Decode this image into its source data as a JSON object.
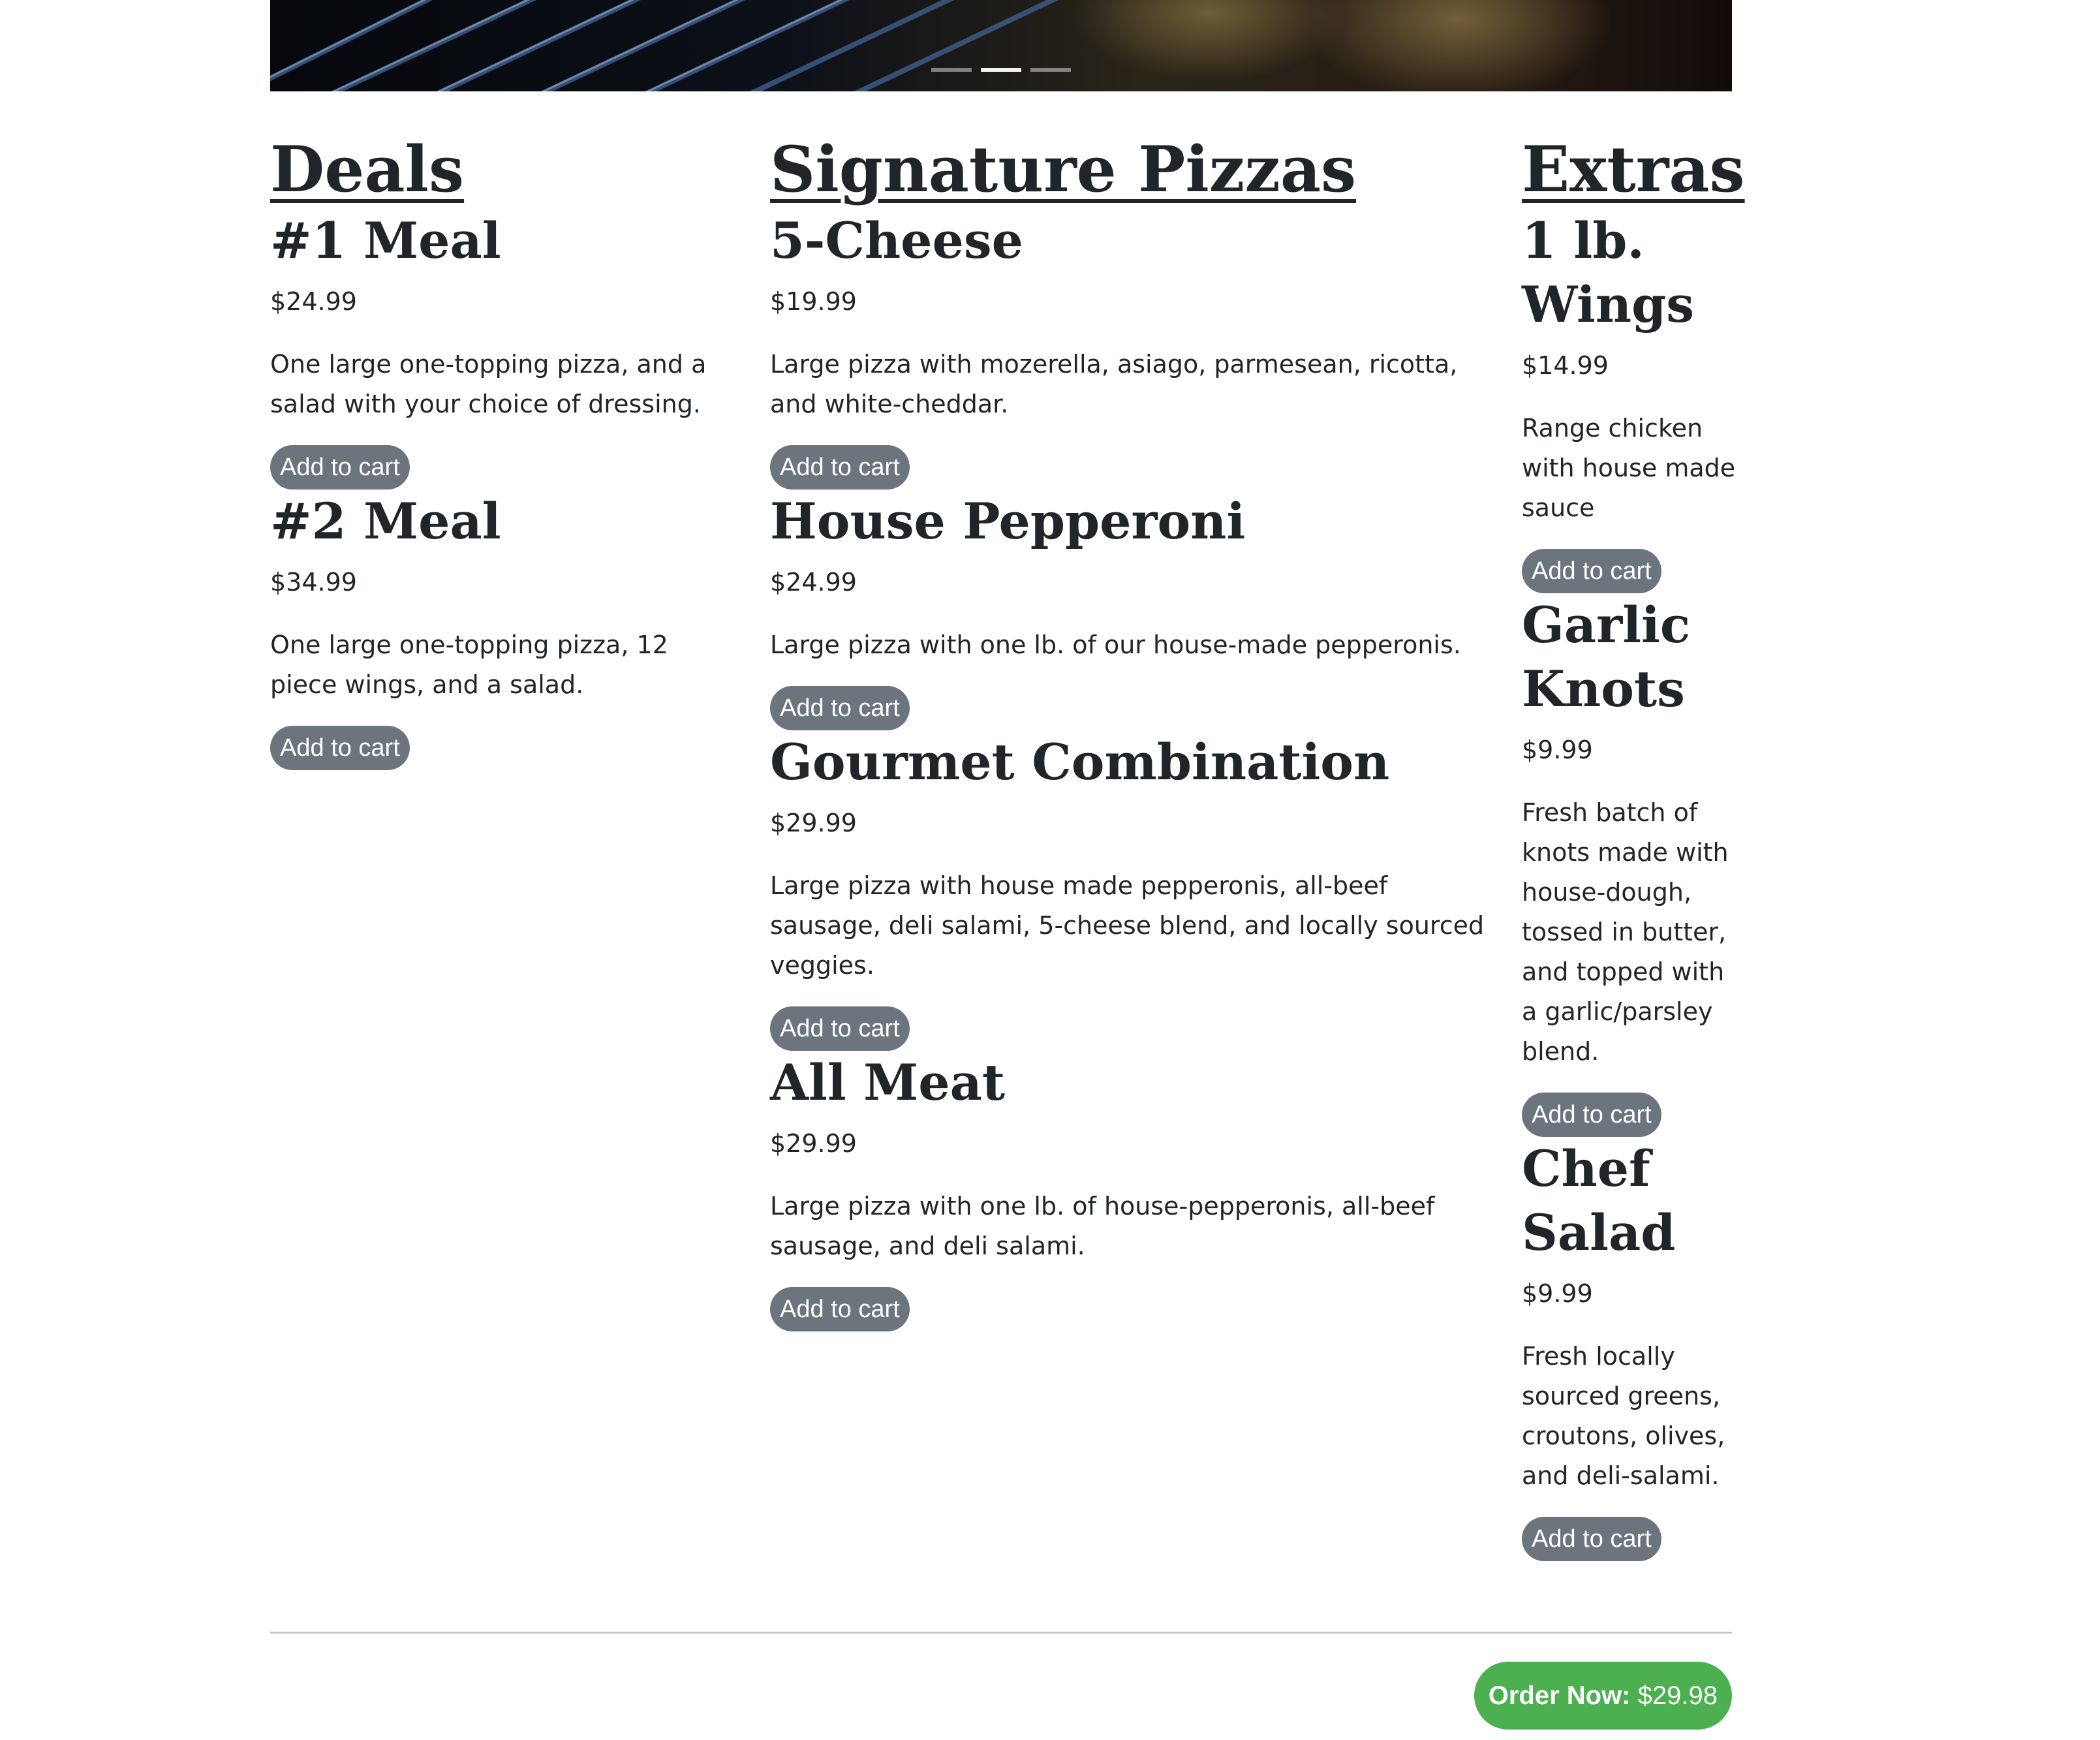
{
  "hero": {
    "indicators": 3,
    "active_indicator": 2
  },
  "sections": {
    "deals": {
      "title": "Deals",
      "items": [
        {
          "name": "#1 Meal",
          "price": "$24.99",
          "desc": "One large one-topping pizza, and a salad with your choice of dressing.",
          "button": "Add to cart"
        },
        {
          "name": "#2 Meal",
          "price": "$34.99",
          "desc": "One large one-topping pizza, 12 piece wings, and a salad.",
          "button": "Add to cart"
        }
      ]
    },
    "pizzas": {
      "title": "Signature Pizzas",
      "items": [
        {
          "name": "5-Cheese",
          "price": "$19.99",
          "desc": "Large pizza with mozerella, asiago, parmesean, ricotta, and white-cheddar.",
          "button": "Add to cart"
        },
        {
          "name": "House Pepperoni",
          "price": "$24.99",
          "desc": "Large pizza with one lb. of our house-made pepperonis.",
          "button": "Add to cart"
        },
        {
          "name": "Gourmet Combination",
          "price": "$29.99",
          "desc": "Large pizza with house made pepperonis, all-beef sausage, deli salami, 5-cheese blend, and locally sourced veggies.",
          "button": "Add to cart"
        },
        {
          "name": "All Meat",
          "price": "$29.99",
          "desc": "Large pizza with one lb. of house-pepperonis, all-beef sausage, and deli salami.",
          "button": "Add to cart"
        }
      ]
    },
    "extras": {
      "title": "Extras",
      "items": [
        {
          "name": "1 lb. Wings",
          "price": "$14.99",
          "desc": "Range chicken with house made sauce",
          "button": "Add to cart"
        },
        {
          "name": "Garlic Knots",
          "price": "$9.99",
          "desc": "Fresh batch of knots made with house-dough, tossed in butter, and topped with a garlic/parsley blend.",
          "button": "Add to cart"
        },
        {
          "name": "Chef Salad",
          "price": "$9.99",
          "desc": "Fresh locally sourced greens, croutons, olives, and deli-salami.",
          "button": "Add to cart"
        }
      ]
    }
  },
  "order": {
    "label": "Order Now:",
    "total": "$29.98"
  },
  "colors": {
    "button_gray": "#6c757d",
    "order_green": "#4caf50",
    "text": "#212529"
  }
}
